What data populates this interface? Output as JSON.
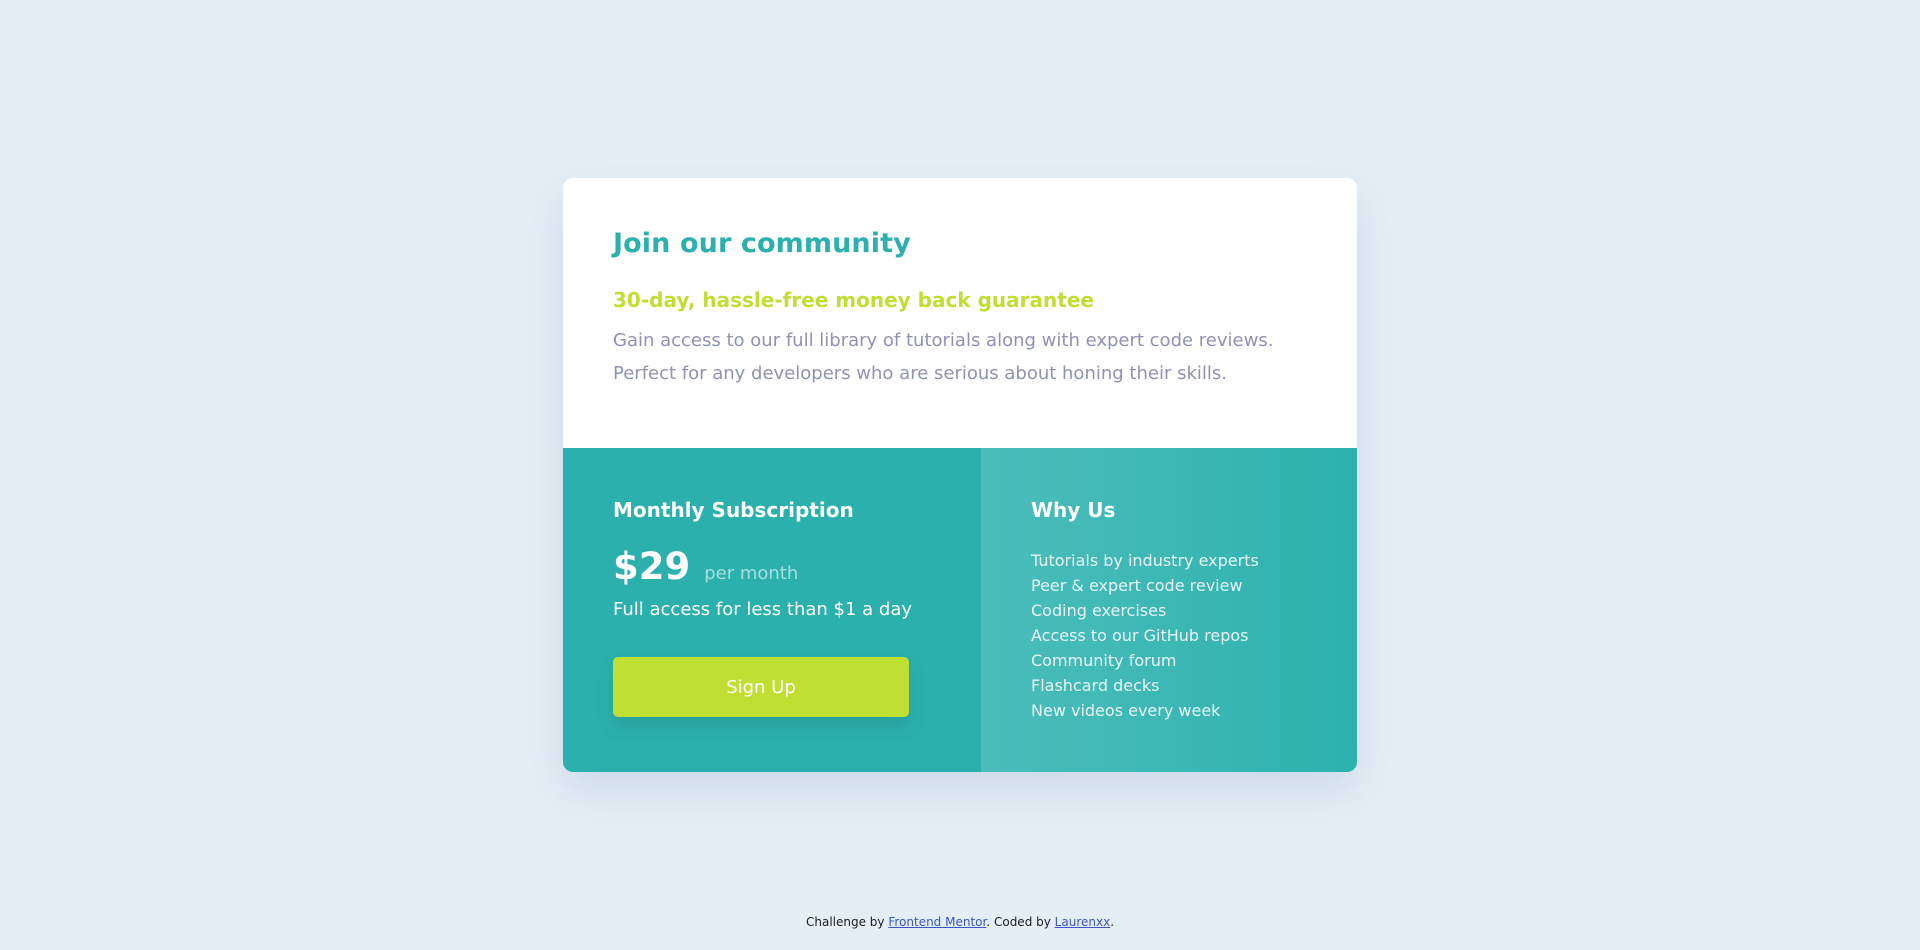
{
  "card": {
    "title": "Join our community",
    "guarantee": "30-day, hassle-free money back guarantee",
    "description": "Gain access to our full library of tutorials along with expert code reviews. Perfect for any developers who are serious about honing their skills."
  },
  "subscription": {
    "heading": "Monthly Subscription",
    "price": "$29",
    "period": "per month",
    "access_text": "Full access for less than $1 a day",
    "button_label": "Sign Up"
  },
  "why_us": {
    "heading": "Why Us",
    "items": [
      "Tutorials by industry experts",
      "Peer & expert code review",
      "Coding exercises",
      "Access to our GitHub repos",
      "Community forum",
      "Flashcard decks",
      "New videos every week"
    ]
  },
  "footer": {
    "prefix": "Challenge by",
    "link_one": "Frontend Mentor",
    "middle": ". Coded by",
    "link_two": "Laurenxx",
    "suffix": "."
  },
  "colors": {
    "page_background": "#e4eef6",
    "teal": "#2bb0ae",
    "lime": "#bfdf32",
    "muted_text": "#8e93b2",
    "link": "#3a57c2"
  }
}
